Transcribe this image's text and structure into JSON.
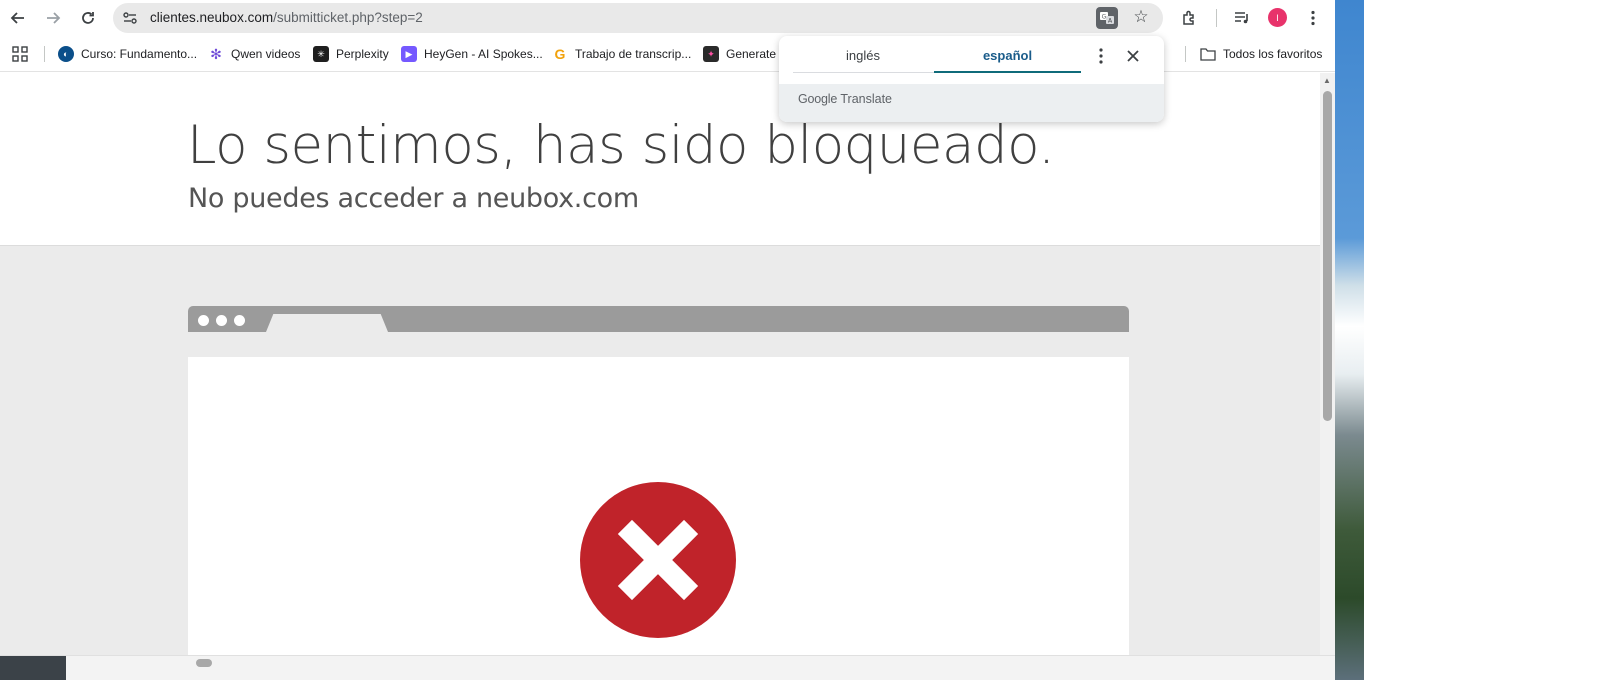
{
  "browser": {
    "url_host": "clientes.neubox.com",
    "url_path": "/submitticket.php?step=2",
    "avatar_initial": "I"
  },
  "bookmarks": [
    {
      "label": "Curso: Fundamento...",
      "icon": "globe-icon",
      "color": "#0b4f8a"
    },
    {
      "label": "Qwen videos",
      "icon": "qwen-icon",
      "color": "#6f4bd8"
    },
    {
      "label": "Perplexity",
      "icon": "perplexity-icon",
      "color": "#1f1f1f"
    },
    {
      "label": "HeyGen - AI Spokes...",
      "icon": "heygen-icon",
      "color": "#7559ff"
    },
    {
      "label": "Trabajo de transcrip...",
      "icon": "trabajo-icon",
      "color": "#f2a20c"
    },
    {
      "label": "Generate V",
      "icon": "generate-icon",
      "color": "#2a2a2a"
    }
  ],
  "bookmarks_all": "Todos los favoritos",
  "translate": {
    "source_lang": "inglés",
    "target_lang": "español",
    "brand_google": "Google",
    "brand_translate": "Translate"
  },
  "page": {
    "title": "Lo sentimos, has sido bloqueado.",
    "subtitle": "No puedes acceder a neubox.com"
  },
  "colors": {
    "error_red": "#c0232a",
    "window_bar": "#9b9b9b",
    "page_bg": "#ebebeb"
  }
}
